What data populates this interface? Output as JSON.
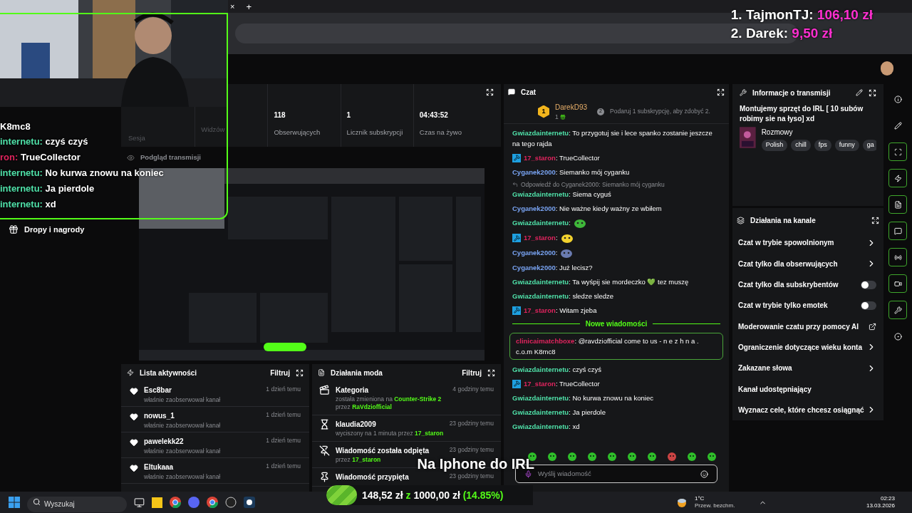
{
  "browser": {
    "tab_close": "×",
    "new_tab": "+"
  },
  "donations": [
    {
      "rank": "1. TajmonTJ:",
      "amount": "106,10 zł"
    },
    {
      "rank": "2. Darek:",
      "amount": "9,50 zł"
    }
  ],
  "webcam_chat": {
    "title": "K8mc8",
    "lines": [
      {
        "user": "internetu:",
        "text": "czyś czyś",
        "color": "#4fe0a8"
      },
      {
        "user": "ron:",
        "text": "TrueCollector",
        "color": "#e0245e"
      },
      {
        "user": "internetu:",
        "text": "No kurwa znowu na koniec",
        "color": "#4fe0a8"
      },
      {
        "user": "internetu:",
        "text": "Ja pierdole",
        "color": "#4fe0a8"
      },
      {
        "user": "internetu:",
        "text": "xd",
        "color": "#4fe0a8"
      }
    ]
  },
  "sidebar": {
    "items": [
      {
        "label": "Dropy i nagrody"
      }
    ]
  },
  "stats": {
    "session_label": "Sesja",
    "items": [
      {
        "label": "Widzów"
      },
      {
        "value": "118",
        "label": "Obserwujących"
      },
      {
        "value": "1",
        "label": "Licznik subskrypcji"
      },
      {
        "value": "04:43:52",
        "label": "Czas na żywo"
      }
    ]
  },
  "preview": {
    "title": "Podgląd transmisji",
    "kind": "picture"
  },
  "activity": {
    "title": "Lista aktywności",
    "filter": "Filtruj",
    "items": [
      {
        "name": "Esc8bar",
        "action": "właśnie zaobserwował kanał",
        "time": "1 dzień temu"
      },
      {
        "name": "nowus_1",
        "action": "właśnie zaobserwował kanał",
        "time": "1 dzień temu"
      },
      {
        "name": "pawelekk22",
        "action": "właśnie zaobserwował kanał",
        "time": "1 dzień temu"
      },
      {
        "name": "Eltukaaa",
        "action": "właśnie zaobserwował kanał",
        "time": "1 dzień temu"
      }
    ]
  },
  "mod_actions": {
    "title": "Działania moda",
    "filter": "Filtruj",
    "items": [
      {
        "kind": "category",
        "title": "Kategoria",
        "time": "4 godziny temu",
        "detail": [
          {
            "text": "została zmieniona na ",
            "highlight": false
          },
          {
            "text": "Counter-Strike 2",
            "highlight": true
          },
          {
            "text": " przez ",
            "highlight": false
          },
          {
            "text": "RaVdziofficial",
            "highlight": true
          }
        ]
      },
      {
        "kind": "timeout",
        "title": "klaudia2009",
        "time": "23 godziny temu",
        "detail": [
          {
            "text": "wyciszony na 1 minuta przez ",
            "highlight": false
          },
          {
            "text": "17_staron",
            "highlight": true
          }
        ]
      },
      {
        "kind": "unpin",
        "title": "Wiadomość została odpięta",
        "time": "23 godziny temu",
        "detail": [
          {
            "text": "przez ",
            "highlight": false
          },
          {
            "text": "17_staron",
            "highlight": true
          }
        ]
      },
      {
        "kind": "pin",
        "title": "Wiadomość przypięta",
        "time": "23 godziny temu"
      }
    ]
  },
  "chat": {
    "title": "Czat",
    "pinned": {
      "user": "DarekD93",
      "rank": "1",
      "count": "1",
      "hint": "Podaruj 1 subskrypcję, aby zdobyć 2.",
      "hint_badge": "2"
    },
    "messages": [
      {
        "kind": "text",
        "user": "Gwiazdainternetu",
        "color": "#4fe0a8",
        "mod": false,
        "text": ": To przygotuj sie i lece spanko zostanie jeszcze na tego rajda"
      },
      {
        "kind": "text",
        "user": "17_staron",
        "color": "#e0245e",
        "mod": true,
        "text": ": TrueCollector"
      },
      {
        "kind": "text",
        "user": "Cyganek2000",
        "color": "#7aa5f5",
        "mod": false,
        "text": ": Siemanko mój cyganku"
      },
      {
        "kind": "reply",
        "reply": "Odpowiedź do Cyganek2000: Siemanko mój cyganku",
        "user": "Gwiazdainternetu",
        "color": "#4fe0a8",
        "mod": false,
        "text": ": Siema cyguś"
      },
      {
        "kind": "text",
        "user": "Cyganek2000",
        "color": "#7aa5f5",
        "mod": false,
        "text": ": Nie ważne kiedy ważny ze wbiłem"
      },
      {
        "kind": "emote",
        "user": "Gwiazdainternetu",
        "color": "#4fe0a8",
        "mod": false,
        "text": ":"
      },
      {
        "kind": "emote",
        "user": "17_staron",
        "color": "#e0245e",
        "mod": true,
        "text": ":"
      },
      {
        "kind": "emote",
        "user": "Cyganek2000",
        "color": "#7aa5f5",
        "mod": false,
        "text": ":"
      },
      {
        "kind": "text",
        "user": "Cyganek2000",
        "color": "#7aa5f5",
        "mod": false,
        "text": ": Już lecisz?"
      },
      {
        "kind": "text",
        "user": "Gwiazdainternetu",
        "color": "#4fe0a8",
        "mod": false,
        "text": ": Ta wyśpij sie mordeczko 💚 tez muszę"
      },
      {
        "kind": "text",
        "user": "Gwiazdainternetu",
        "color": "#4fe0a8",
        "mod": false,
        "text": ": sledze sledze"
      },
      {
        "kind": "text",
        "user": "17_staron",
        "color": "#e0245e",
        "mod": true,
        "text": ": Witam zjeba"
      },
      {
        "kind": "separator",
        "text": "Nowe wiadomości"
      },
      {
        "kind": "highlight",
        "user": "clinicaimatchboxe",
        "color": "#e0245e",
        "mod": false,
        "text": ": @ravdziofficial come to us - n e z h n a . c.o.m K8mc8"
      },
      {
        "kind": "text",
        "user": "Gwiazdainternetu",
        "color": "#4fe0a8",
        "mod": false,
        "text": ": czyś czyś"
      },
      {
        "kind": "text",
        "user": "17_staron",
        "color": "#e0245e",
        "mod": true,
        "text": ": TrueCollector"
      },
      {
        "kind": "text",
        "user": "Gwiazdainternetu",
        "color": "#4fe0a8",
        "mod": false,
        "text": ": No kurwa znowu na koniec"
      },
      {
        "kind": "text",
        "user": "Gwiazdainternetu",
        "color": "#4fe0a8",
        "mod": false,
        "text": ": Ja pierdole"
      },
      {
        "kind": "text",
        "user": "Gwiazdainternetu",
        "color": "#4fe0a8",
        "mod": false,
        "text": ": xd"
      }
    ],
    "input": {
      "placeholder": "Wyślij wiadomość"
    }
  },
  "stream_info": {
    "title": "Informacje o transmisji",
    "stream_title": "Montujemy sprzęt do IRL [ 10 subów robimy sie na łyso] xd",
    "category": "Rozmowy",
    "tags": [
      "Polish",
      "chill",
      "fps",
      "funny",
      "ga"
    ]
  },
  "channel_actions": {
    "title": "Działania na kanale",
    "items": [
      {
        "kind": "arrow",
        "label": "Czat w trybie spowolnionym"
      },
      {
        "kind": "arrow",
        "label": "Czat tylko dla obserwujących"
      },
      {
        "kind": "toggle",
        "label": "Czat tylko dla subskrybentów",
        "on": false
      },
      {
        "kind": "toggle",
        "label": "Czat w trybie tylko emotek",
        "on": false
      },
      {
        "kind": "external",
        "label": "Moderowanie czatu przy pomocy AI"
      },
      {
        "kind": "arrow",
        "label": "Ograniczenie dotyczące wieku konta"
      },
      {
        "kind": "arrow",
        "label": "Zakazane słowa"
      },
      {
        "kind": "plain",
        "label": "Kanał udostępniający"
      },
      {
        "kind": "arrow",
        "label": "Wyznacz cele, które chcesz osiągnąć"
      }
    ]
  },
  "rail": [
    {
      "highlighted": false
    },
    {
      "highlighted": false
    },
    {
      "highlighted": true
    },
    {
      "highlighted": true
    },
    {
      "highlighted": true
    },
    {
      "highlighted": true
    },
    {
      "highlighted": true
    },
    {
      "highlighted": true
    },
    {
      "highlighted": true
    },
    {
      "highlighted": false
    }
  ],
  "goal": {
    "title": "Na Iphone do IRL",
    "current": "148,52 zł",
    "separator": "z",
    "target": "1000,00 zł",
    "percent": "(14.85%)",
    "level": 0.1485
  },
  "taskbar": {
    "search_placeholder": "Wyszukaj",
    "temperature": "1°C",
    "weather": "Przew. bezchm.",
    "time": "02:23",
    "date": "13.03.2026"
  }
}
